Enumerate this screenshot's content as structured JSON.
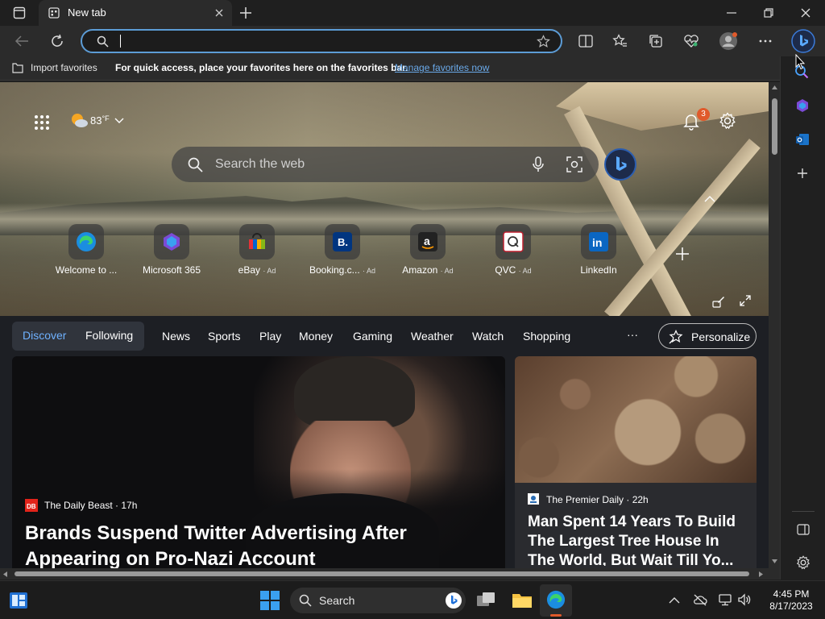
{
  "window": {
    "tab_title": "New tab"
  },
  "address_bar": {
    "value": "",
    "placeholder": ""
  },
  "favorites_bar": {
    "import_label": "Import favorites",
    "hint_text": "For quick access, place your favorites here on the favorites bar.",
    "manage_link": "Manage favorites now"
  },
  "hero": {
    "weather_temp": "83",
    "weather_unit": "°F",
    "notification_count": "3",
    "search_placeholder": "Search the web"
  },
  "quick_links": [
    {
      "label": "Welcome to ...",
      "ad": "",
      "icon": "edge-icon"
    },
    {
      "label": "Microsoft 365",
      "ad": "",
      "icon": "m365-icon"
    },
    {
      "label": "eBay",
      "ad": "· Ad",
      "icon": "ebay-icon"
    },
    {
      "label": "Booking.c...",
      "ad": "· Ad",
      "icon": "booking-icon"
    },
    {
      "label": "Amazon",
      "ad": "· Ad",
      "icon": "amazon-icon"
    },
    {
      "label": "QVC",
      "ad": "· Ad",
      "icon": "qvc-icon"
    },
    {
      "label": "LinkedIn",
      "ad": "",
      "icon": "linkedin-icon"
    }
  ],
  "feed_nav": {
    "discover": "Discover",
    "following": "Following",
    "items": [
      "News",
      "Sports",
      "Play",
      "Money",
      "Gaming",
      "Weather",
      "Watch",
      "Shopping"
    ],
    "more": "···",
    "personalize": "Personalize"
  },
  "cards": [
    {
      "source": "The Daily Beast · 17h",
      "headline": "Brands Suspend Twitter Advertising After Appearing on Pro-Nazi Account"
    },
    {
      "source": "The Premier Daily · 22h",
      "headline": "Man Spent 14 Years To Build The Largest Tree House In The World, But Wait Till Yo..."
    }
  ],
  "taskbar": {
    "search_label": "Search",
    "time": "4:45 PM",
    "date": "8/17/2023"
  },
  "colors": {
    "accent_link": "#6aa9e9",
    "address_border": "#5c9cd6",
    "notification_badge": "#e05a2b"
  }
}
